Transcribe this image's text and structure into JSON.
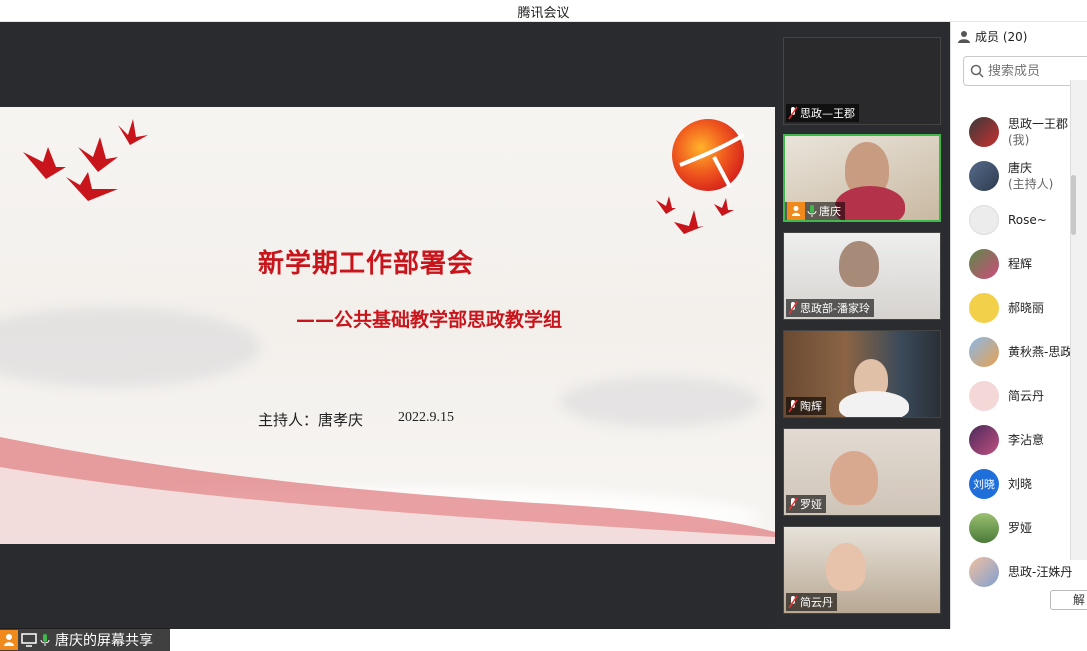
{
  "window": {
    "title": "腾讯会议"
  },
  "slide": {
    "title": "新学期工作部署会",
    "subtitle": "——公共基础教学部思政教学组",
    "host": "主持人：唐孝庆",
    "date": "2022.9.15",
    "accent_color": "#c8141b"
  },
  "share_bar": {
    "label": "唐庆的屏幕共享"
  },
  "video_tiles": [
    {
      "name": "思政—王郡",
      "active": false,
      "host": false
    },
    {
      "name": "唐庆",
      "active": true,
      "host": true
    },
    {
      "name": "思政部-潘家玲",
      "active": false,
      "host": false
    },
    {
      "name": "陶辉",
      "active": false,
      "host": false
    },
    {
      "name": "罗娅",
      "active": false,
      "host": false
    },
    {
      "name": "简云丹",
      "active": false,
      "host": false
    }
  ],
  "members": {
    "header": "成员 (20)",
    "search_placeholder": "搜索成员",
    "list": [
      {
        "name": "思政一王郡",
        "sub": "(我)"
      },
      {
        "name": "唐庆",
        "sub": "(主持人)"
      },
      {
        "name": "Rose~",
        "sub": ""
      },
      {
        "name": "程辉",
        "sub": ""
      },
      {
        "name": "郝晓丽",
        "sub": ""
      },
      {
        "name": "黄秋燕-思政",
        "sub": ""
      },
      {
        "name": "简云丹",
        "sub": ""
      },
      {
        "name": "李沾意",
        "sub": ""
      },
      {
        "name": "刘晓",
        "sub": "",
        "avatar_text": "刘晓"
      },
      {
        "name": "罗娅",
        "sub": ""
      },
      {
        "name": "思政-汪姝丹",
        "sub": ""
      }
    ],
    "bottom_button": "解"
  },
  "colors": {
    "active_border": "#3fb84c",
    "host_badge": "#f08a1c"
  }
}
